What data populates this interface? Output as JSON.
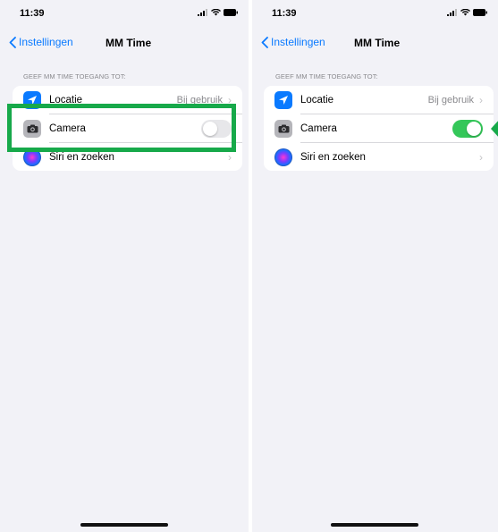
{
  "left": {
    "status_time": "11:39",
    "back_label": "Instellingen",
    "title": "MM Time",
    "section_label": "GEEF MM TIME TOEGANG TOT:",
    "rows": [
      {
        "label": "Locatie",
        "value": "Bij gebruik",
        "icon": "location-arrow-icon"
      },
      {
        "label": "Camera",
        "toggle": "off",
        "icon": "camera-icon"
      },
      {
        "label": "Siri en zoeken",
        "icon": "siri-icon"
      }
    ]
  },
  "right": {
    "status_time": "11:39",
    "back_label": "Instellingen",
    "title": "MM Time",
    "section_label": "GEEF MM TIME TOEGANG TOT:",
    "rows": [
      {
        "label": "Locatie",
        "value": "Bij gebruik",
        "icon": "location-arrow-icon"
      },
      {
        "label": "Camera",
        "toggle": "on",
        "icon": "camera-icon"
      },
      {
        "label": "Siri en zoeken",
        "icon": "siri-icon"
      }
    ]
  },
  "colors": {
    "accent": "#0a7aff",
    "toggle_on": "#34c759",
    "highlight": "#17a94a",
    "background": "#f2f2f7"
  }
}
